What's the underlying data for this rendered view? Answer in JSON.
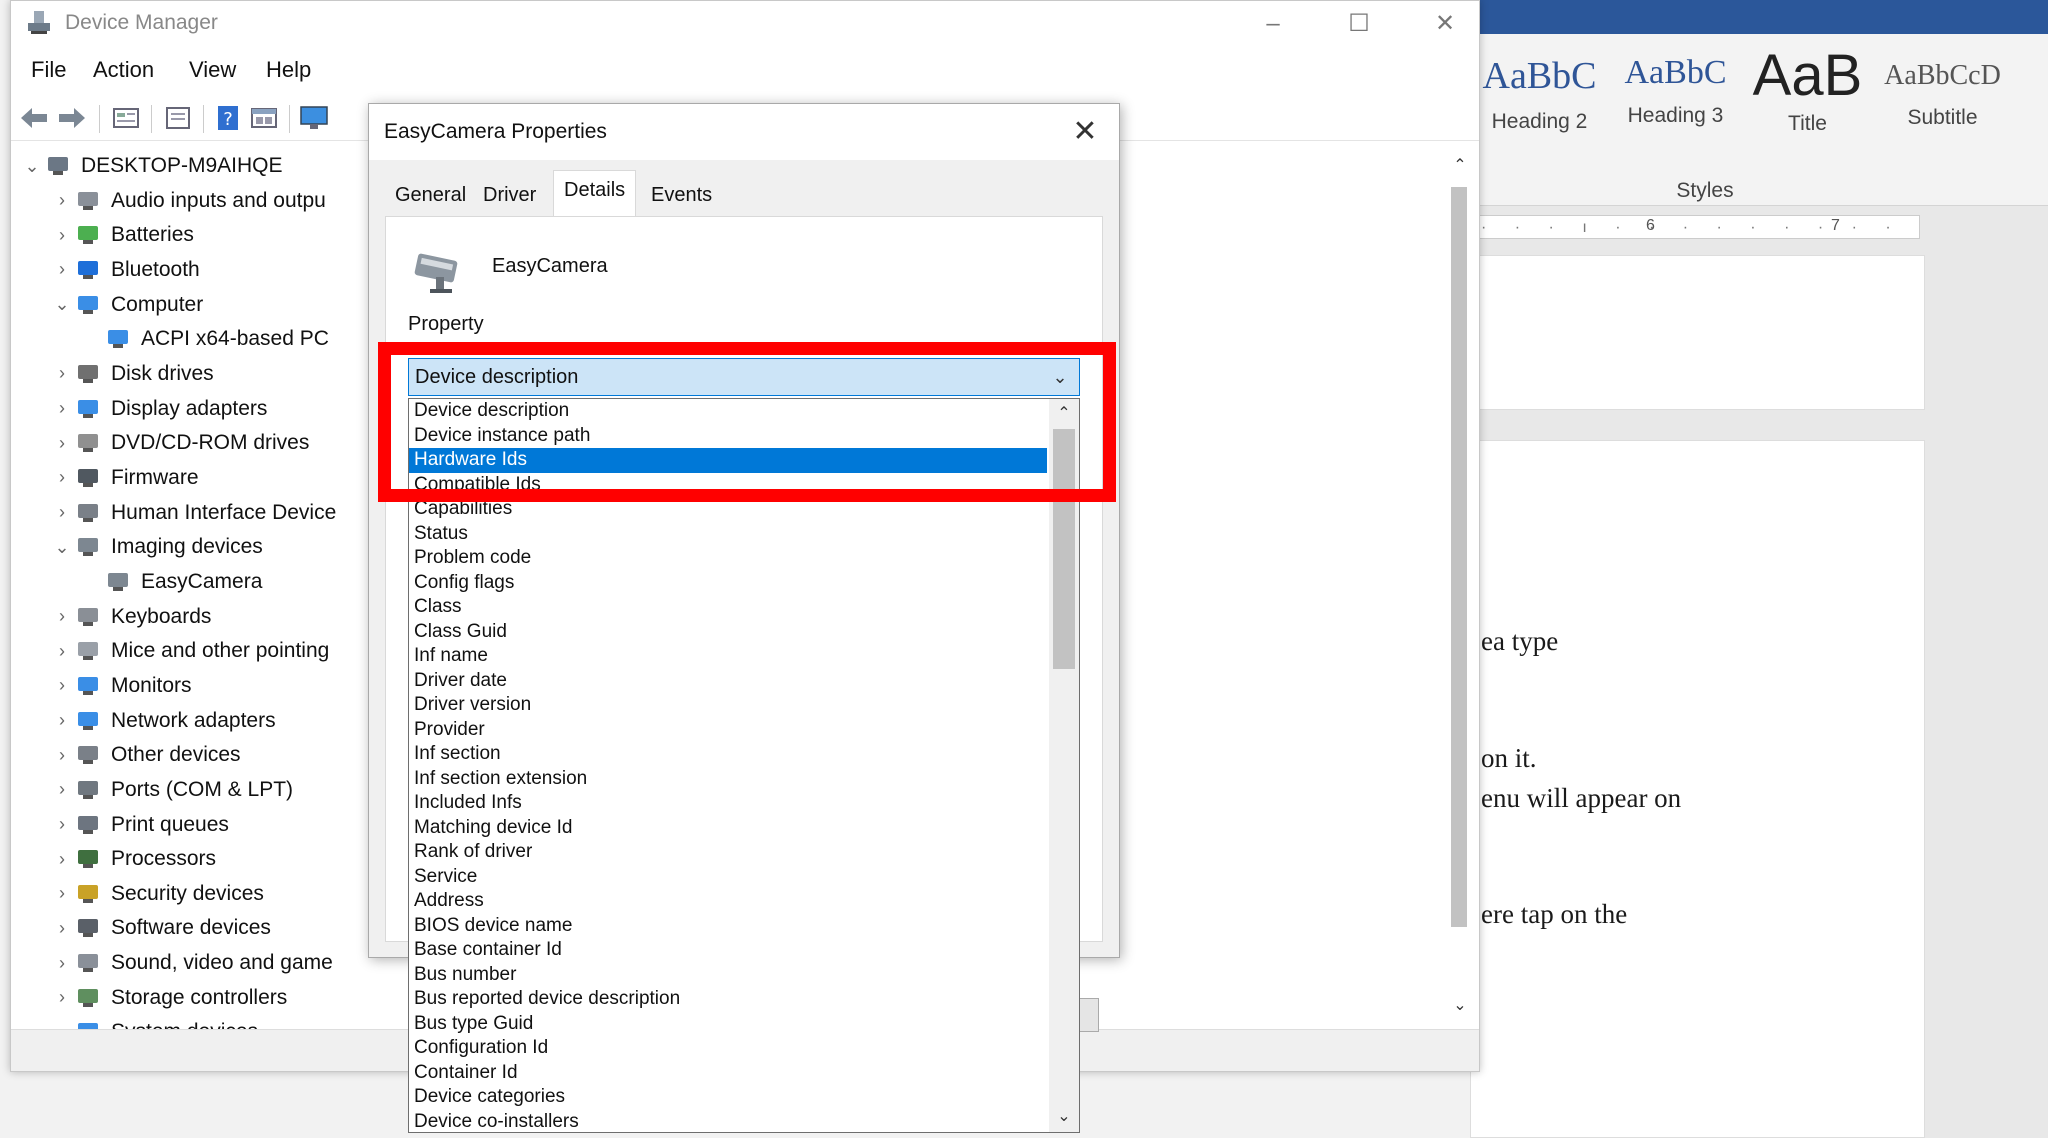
{
  "word": {
    "styles": [
      {
        "sample": "AaBbC",
        "name": "Heading 2"
      },
      {
        "sample": "AaBbC",
        "name": "Heading 3"
      },
      {
        "sample": "AaB",
        "name": "Title"
      },
      {
        "sample": "AaBbCcD",
        "name": "Subtitle"
      }
    ],
    "styles_group_label": "Styles",
    "ruler_numbers": [
      "6",
      "7"
    ],
    "doc_lines": [
      "ea type",
      "on it.",
      "enu will appear on",
      "ere tap on the"
    ],
    "colors": {
      "titlebar": "#2b579a",
      "style_sample": "#2f5597"
    }
  },
  "device_manager": {
    "title": "Device Manager",
    "menu": [
      "File",
      "Action",
      "View",
      "Help"
    ],
    "toolbar_icons": [
      "back-arrow-icon",
      "forward-arrow-icon",
      "properties-icon",
      "update-driver-icon",
      "help-icon",
      "view-icon",
      "monitor-scan-icon"
    ],
    "tree": [
      {
        "label": "DESKTOP-M9AIHQE",
        "expander": "⌄",
        "icon": "computer-root-icon"
      },
      {
        "label": "Audio inputs and outpu",
        "expander": "›",
        "icon": "speaker-icon"
      },
      {
        "label": "Batteries",
        "expander": "›",
        "icon": "battery-icon"
      },
      {
        "label": "Bluetooth",
        "expander": "›",
        "icon": "bluetooth-icon"
      },
      {
        "label": "Computer",
        "expander": "⌄",
        "icon": "computer-icon"
      },
      {
        "label": "ACPI x64-based PC",
        "expander": "",
        "icon": "monitor-icon"
      },
      {
        "label": "Disk drives",
        "expander": "›",
        "icon": "disk-icon"
      },
      {
        "label": "Display adapters",
        "expander": "›",
        "icon": "display-adapter-icon"
      },
      {
        "label": "DVD/CD-ROM drives",
        "expander": "›",
        "icon": "dvd-icon"
      },
      {
        "label": "Firmware",
        "expander": "›",
        "icon": "firmware-icon"
      },
      {
        "label": "Human Interface Device",
        "expander": "›",
        "icon": "hid-icon"
      },
      {
        "label": "Imaging devices",
        "expander": "⌄",
        "icon": "camera-icon"
      },
      {
        "label": "EasyCamera",
        "expander": "",
        "icon": "camera-icon"
      },
      {
        "label": "Keyboards",
        "expander": "›",
        "icon": "keyboard-icon"
      },
      {
        "label": "Mice and other pointing",
        "expander": "›",
        "icon": "mouse-icon"
      },
      {
        "label": "Monitors",
        "expander": "›",
        "icon": "monitor-icon"
      },
      {
        "label": "Network adapters",
        "expander": "›",
        "icon": "network-icon"
      },
      {
        "label": "Other devices",
        "expander": "›",
        "icon": "other-devices-icon"
      },
      {
        "label": "Ports (COM & LPT)",
        "expander": "›",
        "icon": "port-icon"
      },
      {
        "label": "Print queues",
        "expander": "›",
        "icon": "printer-icon"
      },
      {
        "label": "Processors",
        "expander": "›",
        "icon": "processor-icon"
      },
      {
        "label": "Security devices",
        "expander": "›",
        "icon": "security-icon"
      },
      {
        "label": "Software devices",
        "expander": "›",
        "icon": "software-icon"
      },
      {
        "label": "Sound, video and game",
        "expander": "›",
        "icon": "speaker-icon"
      },
      {
        "label": "Storage controllers",
        "expander": "›",
        "icon": "storage-icon"
      },
      {
        "label": "System devices",
        "expander": "›",
        "icon": "system-icon"
      }
    ]
  },
  "dialog": {
    "title": "EasyCamera Properties",
    "close": "✕",
    "tabs": [
      "General",
      "Driver",
      "Details",
      "Events"
    ],
    "active_tab": "Details",
    "device_name": "EasyCamera",
    "property_label": "Property",
    "combo_value": "Device description",
    "options": [
      "Device description",
      "Device instance path",
      "Hardware Ids",
      "Compatible Ids",
      "Capabilities",
      "Status",
      "Problem code",
      "Config flags",
      "Class",
      "Class Guid",
      "Inf name",
      "Driver date",
      "Driver version",
      "Provider",
      "Inf section",
      "Inf section extension",
      "Included Infs",
      "Matching device Id",
      "Rank of driver",
      "Service",
      "Address",
      "BIOS device name",
      "Base container Id",
      "Bus number",
      "Bus reported device description",
      "Bus type Guid",
      "Configuration Id",
      "Container Id",
      "Device categories",
      "Device co-installers"
    ],
    "selected_option": "Hardware Ids",
    "highlight_color": "#ff0000",
    "selection_color": "#0078d7"
  }
}
